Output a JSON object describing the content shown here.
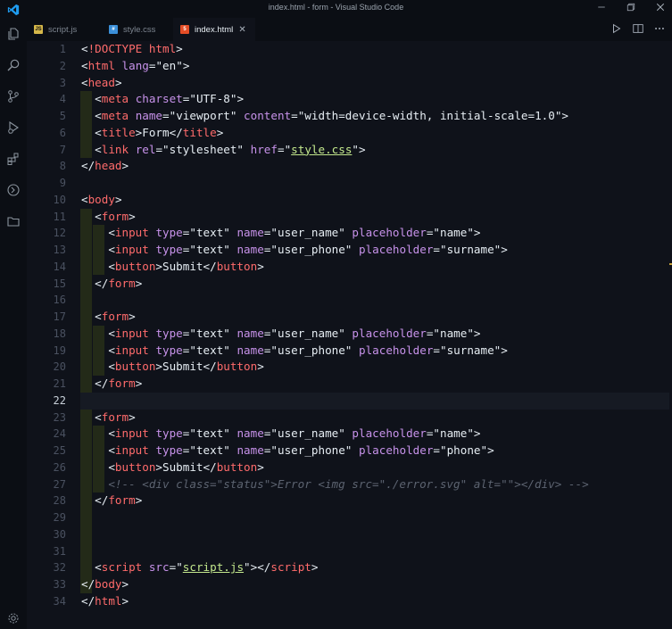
{
  "window": {
    "title": "index.html - form - Visual Studio Code"
  },
  "tabs": [
    {
      "label": "script.js",
      "icon": "js-file-icon",
      "active": false
    },
    {
      "label": "style.css",
      "icon": "css-file-icon",
      "active": false
    },
    {
      "label": "index.html",
      "icon": "html-file-icon",
      "active": true,
      "close": "✕"
    }
  ],
  "activity_bar": [
    "explorer-icon",
    "search-icon",
    "source-control-icon",
    "run-debug-icon",
    "extensions-icon",
    "remote-icon",
    "folder-icon",
    "settings-gear-icon"
  ],
  "editor": {
    "cursor_line": 22,
    "lines": [
      {
        "n": "1",
        "tokens": [
          [
            "c-punc",
            "<"
          ],
          [
            "c-doc",
            "!DOCTYPE html"
          ],
          [
            "c-punc",
            ">"
          ]
        ]
      },
      {
        "n": "2",
        "tokens": [
          [
            "c-punc",
            "<"
          ],
          [
            "c-tag",
            "html"
          ],
          [
            "c-punc",
            " "
          ],
          [
            "c-attr",
            "lang"
          ],
          [
            "c-punc",
            "="
          ],
          [
            "c-str",
            "\"en\""
          ],
          [
            "c-punc",
            ">"
          ]
        ]
      },
      {
        "n": "3",
        "tokens": [
          [
            "c-punc",
            "<"
          ],
          [
            "c-tag",
            "head"
          ],
          [
            "c-punc",
            ">"
          ]
        ]
      },
      {
        "n": "4",
        "tokens": [
          [
            "c-punc",
            "  <"
          ],
          [
            "c-tag",
            "meta"
          ],
          [
            "c-punc",
            " "
          ],
          [
            "c-attr",
            "charset"
          ],
          [
            "c-punc",
            "="
          ],
          [
            "c-str",
            "\"UTF-8\""
          ],
          [
            "c-punc",
            ">"
          ]
        ]
      },
      {
        "n": "5",
        "tokens": [
          [
            "c-punc",
            "  <"
          ],
          [
            "c-tag",
            "meta"
          ],
          [
            "c-punc",
            " "
          ],
          [
            "c-attr",
            "name"
          ],
          [
            "c-punc",
            "="
          ],
          [
            "c-str",
            "\"viewport\""
          ],
          [
            "c-punc",
            " "
          ],
          [
            "c-attr",
            "content"
          ],
          [
            "c-punc",
            "="
          ],
          [
            "c-str",
            "\"width=device-width, initial-scale=1.0\""
          ],
          [
            "c-punc",
            ">"
          ]
        ]
      },
      {
        "n": "6",
        "tokens": [
          [
            "c-punc",
            "  <"
          ],
          [
            "c-tag",
            "title"
          ],
          [
            "c-punc",
            ">"
          ],
          [
            "c-text",
            "Form"
          ],
          [
            "c-punc",
            "</"
          ],
          [
            "c-tag",
            "title"
          ],
          [
            "c-punc",
            ">"
          ]
        ]
      },
      {
        "n": "7",
        "tokens": [
          [
            "c-punc",
            "  <"
          ],
          [
            "c-tag",
            "link"
          ],
          [
            "c-punc",
            " "
          ],
          [
            "c-attr",
            "rel"
          ],
          [
            "c-punc",
            "="
          ],
          [
            "c-str",
            "\"stylesheet\""
          ],
          [
            "c-punc",
            " "
          ],
          [
            "c-attr",
            "href"
          ],
          [
            "c-punc",
            "="
          ],
          [
            "c-str",
            "\""
          ],
          [
            "c-link",
            "style.css"
          ],
          [
            "c-str",
            "\""
          ],
          [
            "c-punc",
            ">"
          ]
        ]
      },
      {
        "n": "8",
        "tokens": [
          [
            "c-punc",
            "</"
          ],
          [
            "c-tag",
            "head"
          ],
          [
            "c-punc",
            ">"
          ]
        ]
      },
      {
        "n": "9",
        "tokens": []
      },
      {
        "n": "10",
        "tokens": [
          [
            "c-punc",
            "<"
          ],
          [
            "c-tag",
            "body"
          ],
          [
            "c-punc",
            ">"
          ]
        ]
      },
      {
        "n": "11",
        "tokens": [
          [
            "c-punc",
            "  <"
          ],
          [
            "c-tag",
            "form"
          ],
          [
            "c-punc",
            ">"
          ]
        ]
      },
      {
        "n": "12",
        "tokens": [
          [
            "c-punc",
            "    <"
          ],
          [
            "c-tag",
            "input"
          ],
          [
            "c-punc",
            " "
          ],
          [
            "c-attr",
            "type"
          ],
          [
            "c-punc",
            "="
          ],
          [
            "c-str",
            "\"text\""
          ],
          [
            "c-punc",
            " "
          ],
          [
            "c-attr",
            "name"
          ],
          [
            "c-punc",
            "="
          ],
          [
            "c-str",
            "\"user_name\""
          ],
          [
            "c-punc",
            " "
          ],
          [
            "c-attr",
            "placeholder"
          ],
          [
            "c-punc",
            "="
          ],
          [
            "c-str",
            "\"name\""
          ],
          [
            "c-punc",
            ">"
          ]
        ]
      },
      {
        "n": "13",
        "tokens": [
          [
            "c-punc",
            "    <"
          ],
          [
            "c-tag",
            "input"
          ],
          [
            "c-punc",
            " "
          ],
          [
            "c-attr",
            "type"
          ],
          [
            "c-punc",
            "="
          ],
          [
            "c-str",
            "\"text\""
          ],
          [
            "c-punc",
            " "
          ],
          [
            "c-attr",
            "name"
          ],
          [
            "c-punc",
            "="
          ],
          [
            "c-str",
            "\"user_phone\""
          ],
          [
            "c-punc",
            " "
          ],
          [
            "c-attr",
            "placeholder"
          ],
          [
            "c-punc",
            "="
          ],
          [
            "c-str",
            "\"surname\""
          ],
          [
            "c-punc",
            ">"
          ]
        ]
      },
      {
        "n": "14",
        "tokens": [
          [
            "c-punc",
            "    <"
          ],
          [
            "c-tag",
            "button"
          ],
          [
            "c-punc",
            ">"
          ],
          [
            "c-text",
            "Submit"
          ],
          [
            "c-punc",
            "</"
          ],
          [
            "c-tag",
            "button"
          ],
          [
            "c-punc",
            ">"
          ]
        ]
      },
      {
        "n": "15",
        "tokens": [
          [
            "c-punc",
            "  </"
          ],
          [
            "c-tag",
            "form"
          ],
          [
            "c-punc",
            ">"
          ]
        ]
      },
      {
        "n": "16",
        "tokens": []
      },
      {
        "n": "17",
        "tokens": [
          [
            "c-punc",
            "  <"
          ],
          [
            "c-tag",
            "form"
          ],
          [
            "c-punc",
            ">"
          ]
        ]
      },
      {
        "n": "18",
        "tokens": [
          [
            "c-punc",
            "    <"
          ],
          [
            "c-tag",
            "input"
          ],
          [
            "c-punc",
            " "
          ],
          [
            "c-attr",
            "type"
          ],
          [
            "c-punc",
            "="
          ],
          [
            "c-str",
            "\"text\""
          ],
          [
            "c-punc",
            " "
          ],
          [
            "c-attr",
            "name"
          ],
          [
            "c-punc",
            "="
          ],
          [
            "c-str",
            "\"user_name\""
          ],
          [
            "c-punc",
            " "
          ],
          [
            "c-attr",
            "placeholder"
          ],
          [
            "c-punc",
            "="
          ],
          [
            "c-str",
            "\"name\""
          ],
          [
            "c-punc",
            ">"
          ]
        ]
      },
      {
        "n": "19",
        "tokens": [
          [
            "c-punc",
            "    <"
          ],
          [
            "c-tag",
            "input"
          ],
          [
            "c-punc",
            " "
          ],
          [
            "c-attr",
            "type"
          ],
          [
            "c-punc",
            "="
          ],
          [
            "c-str",
            "\"text\""
          ],
          [
            "c-punc",
            " "
          ],
          [
            "c-attr",
            "name"
          ],
          [
            "c-punc",
            "="
          ],
          [
            "c-str",
            "\"user_phone\""
          ],
          [
            "c-punc",
            " "
          ],
          [
            "c-attr",
            "placeholder"
          ],
          [
            "c-punc",
            "="
          ],
          [
            "c-str",
            "\"surname\""
          ],
          [
            "c-punc",
            ">"
          ]
        ]
      },
      {
        "n": "20",
        "tokens": [
          [
            "c-punc",
            "    <"
          ],
          [
            "c-tag",
            "button"
          ],
          [
            "c-punc",
            ">"
          ],
          [
            "c-text",
            "Submit"
          ],
          [
            "c-punc",
            "</"
          ],
          [
            "c-tag",
            "button"
          ],
          [
            "c-punc",
            ">"
          ]
        ]
      },
      {
        "n": "21",
        "tokens": [
          [
            "c-punc",
            "  </"
          ],
          [
            "c-tag",
            "form"
          ],
          [
            "c-punc",
            ">"
          ]
        ]
      },
      {
        "n": "22",
        "tokens": []
      },
      {
        "n": "23",
        "tokens": [
          [
            "c-punc",
            "  <"
          ],
          [
            "c-tag",
            "form"
          ],
          [
            "c-punc",
            ">"
          ]
        ]
      },
      {
        "n": "24",
        "tokens": [
          [
            "c-punc",
            "    <"
          ],
          [
            "c-tag",
            "input"
          ],
          [
            "c-punc",
            " "
          ],
          [
            "c-attr",
            "type"
          ],
          [
            "c-punc",
            "="
          ],
          [
            "c-str",
            "\"text\""
          ],
          [
            "c-punc",
            " "
          ],
          [
            "c-attr",
            "name"
          ],
          [
            "c-punc",
            "="
          ],
          [
            "c-str",
            "\"user_name\""
          ],
          [
            "c-punc",
            " "
          ],
          [
            "c-attr",
            "placeholder"
          ],
          [
            "c-punc",
            "="
          ],
          [
            "c-str",
            "\"name\""
          ],
          [
            "c-punc",
            ">"
          ]
        ]
      },
      {
        "n": "25",
        "tokens": [
          [
            "c-punc",
            "    <"
          ],
          [
            "c-tag",
            "input"
          ],
          [
            "c-punc",
            " "
          ],
          [
            "c-attr",
            "type"
          ],
          [
            "c-punc",
            "="
          ],
          [
            "c-str",
            "\"text\""
          ],
          [
            "c-punc",
            " "
          ],
          [
            "c-attr",
            "name"
          ],
          [
            "c-punc",
            "="
          ],
          [
            "c-str",
            "\"user_phone\""
          ],
          [
            "c-punc",
            " "
          ],
          [
            "c-attr",
            "placeholder"
          ],
          [
            "c-punc",
            "="
          ],
          [
            "c-str",
            "\"phone\""
          ],
          [
            "c-punc",
            ">"
          ]
        ]
      },
      {
        "n": "26",
        "tokens": [
          [
            "c-punc",
            "    <"
          ],
          [
            "c-tag",
            "button"
          ],
          [
            "c-punc",
            ">"
          ],
          [
            "c-text",
            "Submit"
          ],
          [
            "c-punc",
            "</"
          ],
          [
            "c-tag",
            "button"
          ],
          [
            "c-punc",
            ">"
          ]
        ]
      },
      {
        "n": "27",
        "tokens": [
          [
            "c-cmt",
            "    <!-- <div class=\"status\">Error <img src=\"./error.svg\" alt=\"\"></div> -->"
          ]
        ]
      },
      {
        "n": "28",
        "tokens": [
          [
            "c-punc",
            "  </"
          ],
          [
            "c-tag",
            "form"
          ],
          [
            "c-punc",
            ">"
          ]
        ]
      },
      {
        "n": "29",
        "tokens": []
      },
      {
        "n": "30",
        "tokens": []
      },
      {
        "n": "31",
        "tokens": []
      },
      {
        "n": "32",
        "tokens": [
          [
            "c-punc",
            "  <"
          ],
          [
            "c-tag",
            "script"
          ],
          [
            "c-punc",
            " "
          ],
          [
            "c-attr",
            "src"
          ],
          [
            "c-punc",
            "="
          ],
          [
            "c-str",
            "\""
          ],
          [
            "c-link",
            "script.js"
          ],
          [
            "c-str",
            "\""
          ],
          [
            "c-punc",
            "></"
          ],
          [
            "c-tag",
            "script"
          ],
          [
            "c-punc",
            ">"
          ]
        ]
      },
      {
        "n": "33",
        "tokens": [
          [
            "c-punc",
            "</"
          ],
          [
            "c-tag",
            "body"
          ],
          [
            "c-punc",
            ">"
          ]
        ]
      },
      {
        "n": "34",
        "tokens": [
          [
            "c-punc",
            "</"
          ],
          [
            "c-tag",
            "html"
          ],
          [
            "c-punc",
            ">"
          ]
        ]
      }
    ]
  }
}
